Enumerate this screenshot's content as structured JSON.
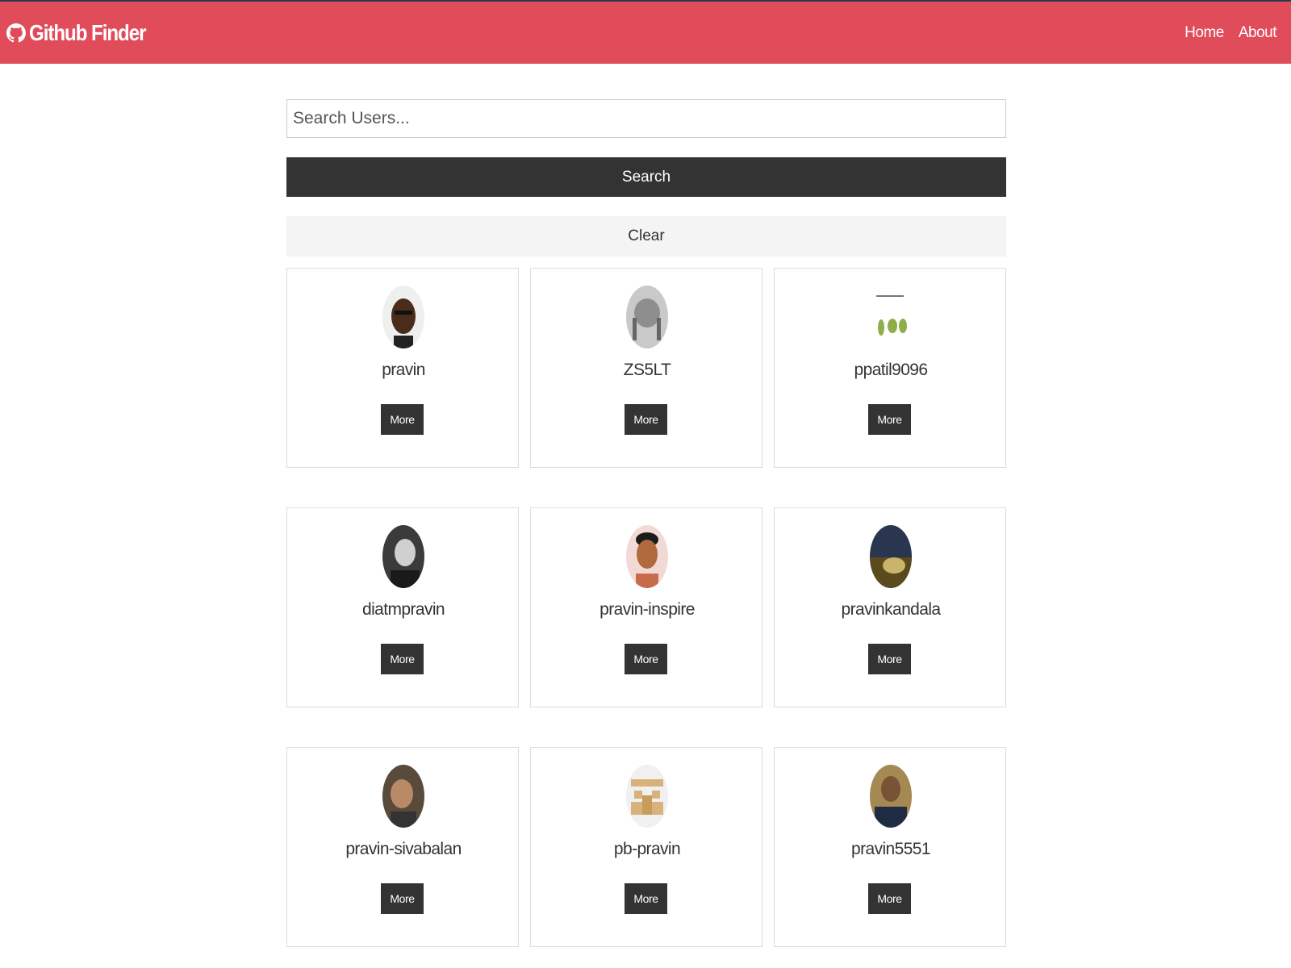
{
  "colors": {
    "primary": "#e04c5a",
    "dark": "#333333",
    "light": "#f4f4f4"
  },
  "navbar": {
    "brand_icon": "github-icon",
    "title": "Github Finder",
    "links": [
      "Home",
      "About"
    ]
  },
  "search": {
    "placeholder": "Search Users...",
    "value": "",
    "submit_label": "Search",
    "clear_label": "Clear"
  },
  "users": [
    {
      "login": "pravin",
      "avatar": "man-glasses-photo",
      "more_label": "More"
    },
    {
      "login": "ZS5LT",
      "avatar": "robot-sculpture-photo",
      "more_label": "More"
    },
    {
      "login": "ppatil9096",
      "avatar": "cartoon-figures-drawing",
      "more_label": "More"
    },
    {
      "login": "diatmpravin",
      "avatar": "man-bw-photo",
      "more_label": "More"
    },
    {
      "login": "pravin-inspire",
      "avatar": "man-portrait-photo",
      "more_label": "More"
    },
    {
      "login": "pravinkandala",
      "avatar": "landscape-photo",
      "more_label": "More"
    },
    {
      "login": "pravin-sivabalan",
      "avatar": "smiling-man-photo",
      "more_label": "More"
    },
    {
      "login": "pb-pravin",
      "avatar": "identicon",
      "more_label": "More"
    },
    {
      "login": "pravin5551",
      "avatar": "man-suit-photo",
      "more_label": "More"
    }
  ]
}
